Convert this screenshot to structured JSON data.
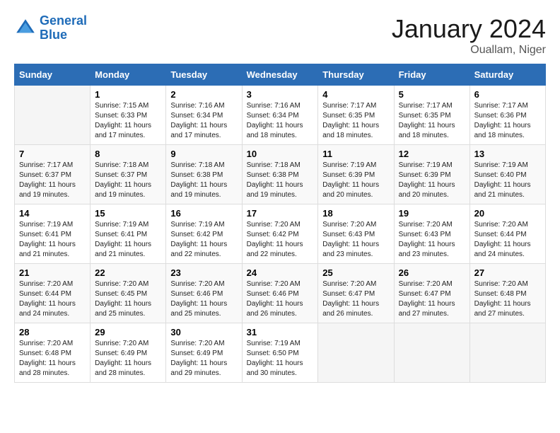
{
  "header": {
    "logo_line1": "General",
    "logo_line2": "Blue",
    "month_year": "January 2024",
    "location": "Ouallam, Niger"
  },
  "weekdays": [
    "Sunday",
    "Monday",
    "Tuesday",
    "Wednesday",
    "Thursday",
    "Friday",
    "Saturday"
  ],
  "weeks": [
    [
      {
        "day": "",
        "sunrise": "",
        "sunset": "",
        "daylight": ""
      },
      {
        "day": "1",
        "sunrise": "7:15 AM",
        "sunset": "6:33 PM",
        "daylight": "11 hours and 17 minutes."
      },
      {
        "day": "2",
        "sunrise": "7:16 AM",
        "sunset": "6:34 PM",
        "daylight": "11 hours and 17 minutes."
      },
      {
        "day": "3",
        "sunrise": "7:16 AM",
        "sunset": "6:34 PM",
        "daylight": "11 hours and 18 minutes."
      },
      {
        "day": "4",
        "sunrise": "7:17 AM",
        "sunset": "6:35 PM",
        "daylight": "11 hours and 18 minutes."
      },
      {
        "day": "5",
        "sunrise": "7:17 AM",
        "sunset": "6:35 PM",
        "daylight": "11 hours and 18 minutes."
      },
      {
        "day": "6",
        "sunrise": "7:17 AM",
        "sunset": "6:36 PM",
        "daylight": "11 hours and 18 minutes."
      }
    ],
    [
      {
        "day": "7",
        "sunrise": "7:17 AM",
        "sunset": "6:37 PM",
        "daylight": "11 hours and 19 minutes."
      },
      {
        "day": "8",
        "sunrise": "7:18 AM",
        "sunset": "6:37 PM",
        "daylight": "11 hours and 19 minutes."
      },
      {
        "day": "9",
        "sunrise": "7:18 AM",
        "sunset": "6:38 PM",
        "daylight": "11 hours and 19 minutes."
      },
      {
        "day": "10",
        "sunrise": "7:18 AM",
        "sunset": "6:38 PM",
        "daylight": "11 hours and 19 minutes."
      },
      {
        "day": "11",
        "sunrise": "7:19 AM",
        "sunset": "6:39 PM",
        "daylight": "11 hours and 20 minutes."
      },
      {
        "day": "12",
        "sunrise": "7:19 AM",
        "sunset": "6:39 PM",
        "daylight": "11 hours and 20 minutes."
      },
      {
        "day": "13",
        "sunrise": "7:19 AM",
        "sunset": "6:40 PM",
        "daylight": "11 hours and 21 minutes."
      }
    ],
    [
      {
        "day": "14",
        "sunrise": "7:19 AM",
        "sunset": "6:41 PM",
        "daylight": "11 hours and 21 minutes."
      },
      {
        "day": "15",
        "sunrise": "7:19 AM",
        "sunset": "6:41 PM",
        "daylight": "11 hours and 21 minutes."
      },
      {
        "day": "16",
        "sunrise": "7:19 AM",
        "sunset": "6:42 PM",
        "daylight": "11 hours and 22 minutes."
      },
      {
        "day": "17",
        "sunrise": "7:20 AM",
        "sunset": "6:42 PM",
        "daylight": "11 hours and 22 minutes."
      },
      {
        "day": "18",
        "sunrise": "7:20 AM",
        "sunset": "6:43 PM",
        "daylight": "11 hours and 23 minutes."
      },
      {
        "day": "19",
        "sunrise": "7:20 AM",
        "sunset": "6:43 PM",
        "daylight": "11 hours and 23 minutes."
      },
      {
        "day": "20",
        "sunrise": "7:20 AM",
        "sunset": "6:44 PM",
        "daylight": "11 hours and 24 minutes."
      }
    ],
    [
      {
        "day": "21",
        "sunrise": "7:20 AM",
        "sunset": "6:44 PM",
        "daylight": "11 hours and 24 minutes."
      },
      {
        "day": "22",
        "sunrise": "7:20 AM",
        "sunset": "6:45 PM",
        "daylight": "11 hours and 25 minutes."
      },
      {
        "day": "23",
        "sunrise": "7:20 AM",
        "sunset": "6:46 PM",
        "daylight": "11 hours and 25 minutes."
      },
      {
        "day": "24",
        "sunrise": "7:20 AM",
        "sunset": "6:46 PM",
        "daylight": "11 hours and 26 minutes."
      },
      {
        "day": "25",
        "sunrise": "7:20 AM",
        "sunset": "6:47 PM",
        "daylight": "11 hours and 26 minutes."
      },
      {
        "day": "26",
        "sunrise": "7:20 AM",
        "sunset": "6:47 PM",
        "daylight": "11 hours and 27 minutes."
      },
      {
        "day": "27",
        "sunrise": "7:20 AM",
        "sunset": "6:48 PM",
        "daylight": "11 hours and 27 minutes."
      }
    ],
    [
      {
        "day": "28",
        "sunrise": "7:20 AM",
        "sunset": "6:48 PM",
        "daylight": "11 hours and 28 minutes."
      },
      {
        "day": "29",
        "sunrise": "7:20 AM",
        "sunset": "6:49 PM",
        "daylight": "11 hours and 28 minutes."
      },
      {
        "day": "30",
        "sunrise": "7:20 AM",
        "sunset": "6:49 PM",
        "daylight": "11 hours and 29 minutes."
      },
      {
        "day": "31",
        "sunrise": "7:19 AM",
        "sunset": "6:50 PM",
        "daylight": "11 hours and 30 minutes."
      },
      {
        "day": "",
        "sunrise": "",
        "sunset": "",
        "daylight": ""
      },
      {
        "day": "",
        "sunrise": "",
        "sunset": "",
        "daylight": ""
      },
      {
        "day": "",
        "sunrise": "",
        "sunset": "",
        "daylight": ""
      }
    ]
  ]
}
